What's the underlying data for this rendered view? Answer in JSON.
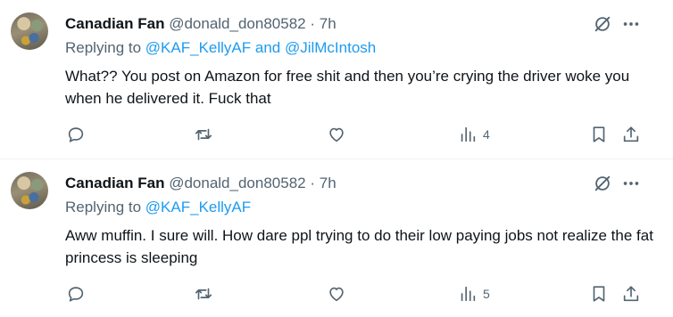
{
  "tweets": [
    {
      "name": "Canadian Fan",
      "handle": "@donald_don80582",
      "separator": "·",
      "time": "7h",
      "replying_prefix": "Replying to",
      "replying_mentions": "@KAF_KellyAF and @JilMcIntosh",
      "text": "What?? You post on Amazon for free shit and then you’re crying the driver woke you when he delivered it. Fuck that",
      "views": "4"
    },
    {
      "name": "Canadian Fan",
      "handle": "@donald_don80582",
      "separator": "·",
      "time": "7h",
      "replying_prefix": "Replying to",
      "replying_mentions": "@KAF_KellyAF",
      "text": "Aww muffin. I sure will. How dare ppl trying to do their low paying jobs not realize the fat princess is sleeping",
      "views": "5"
    }
  ],
  "icons": {
    "grok": "grok-icon",
    "more": "more-icon",
    "reply": "reply-icon",
    "repost": "repost-icon",
    "like": "like-icon",
    "views": "views-icon",
    "bookmark": "bookmark-icon",
    "share": "share-icon"
  },
  "colors": {
    "text": "#0f1419",
    "secondary": "#536471",
    "accent": "#1d9bf0",
    "divider": "#eff3f4"
  }
}
